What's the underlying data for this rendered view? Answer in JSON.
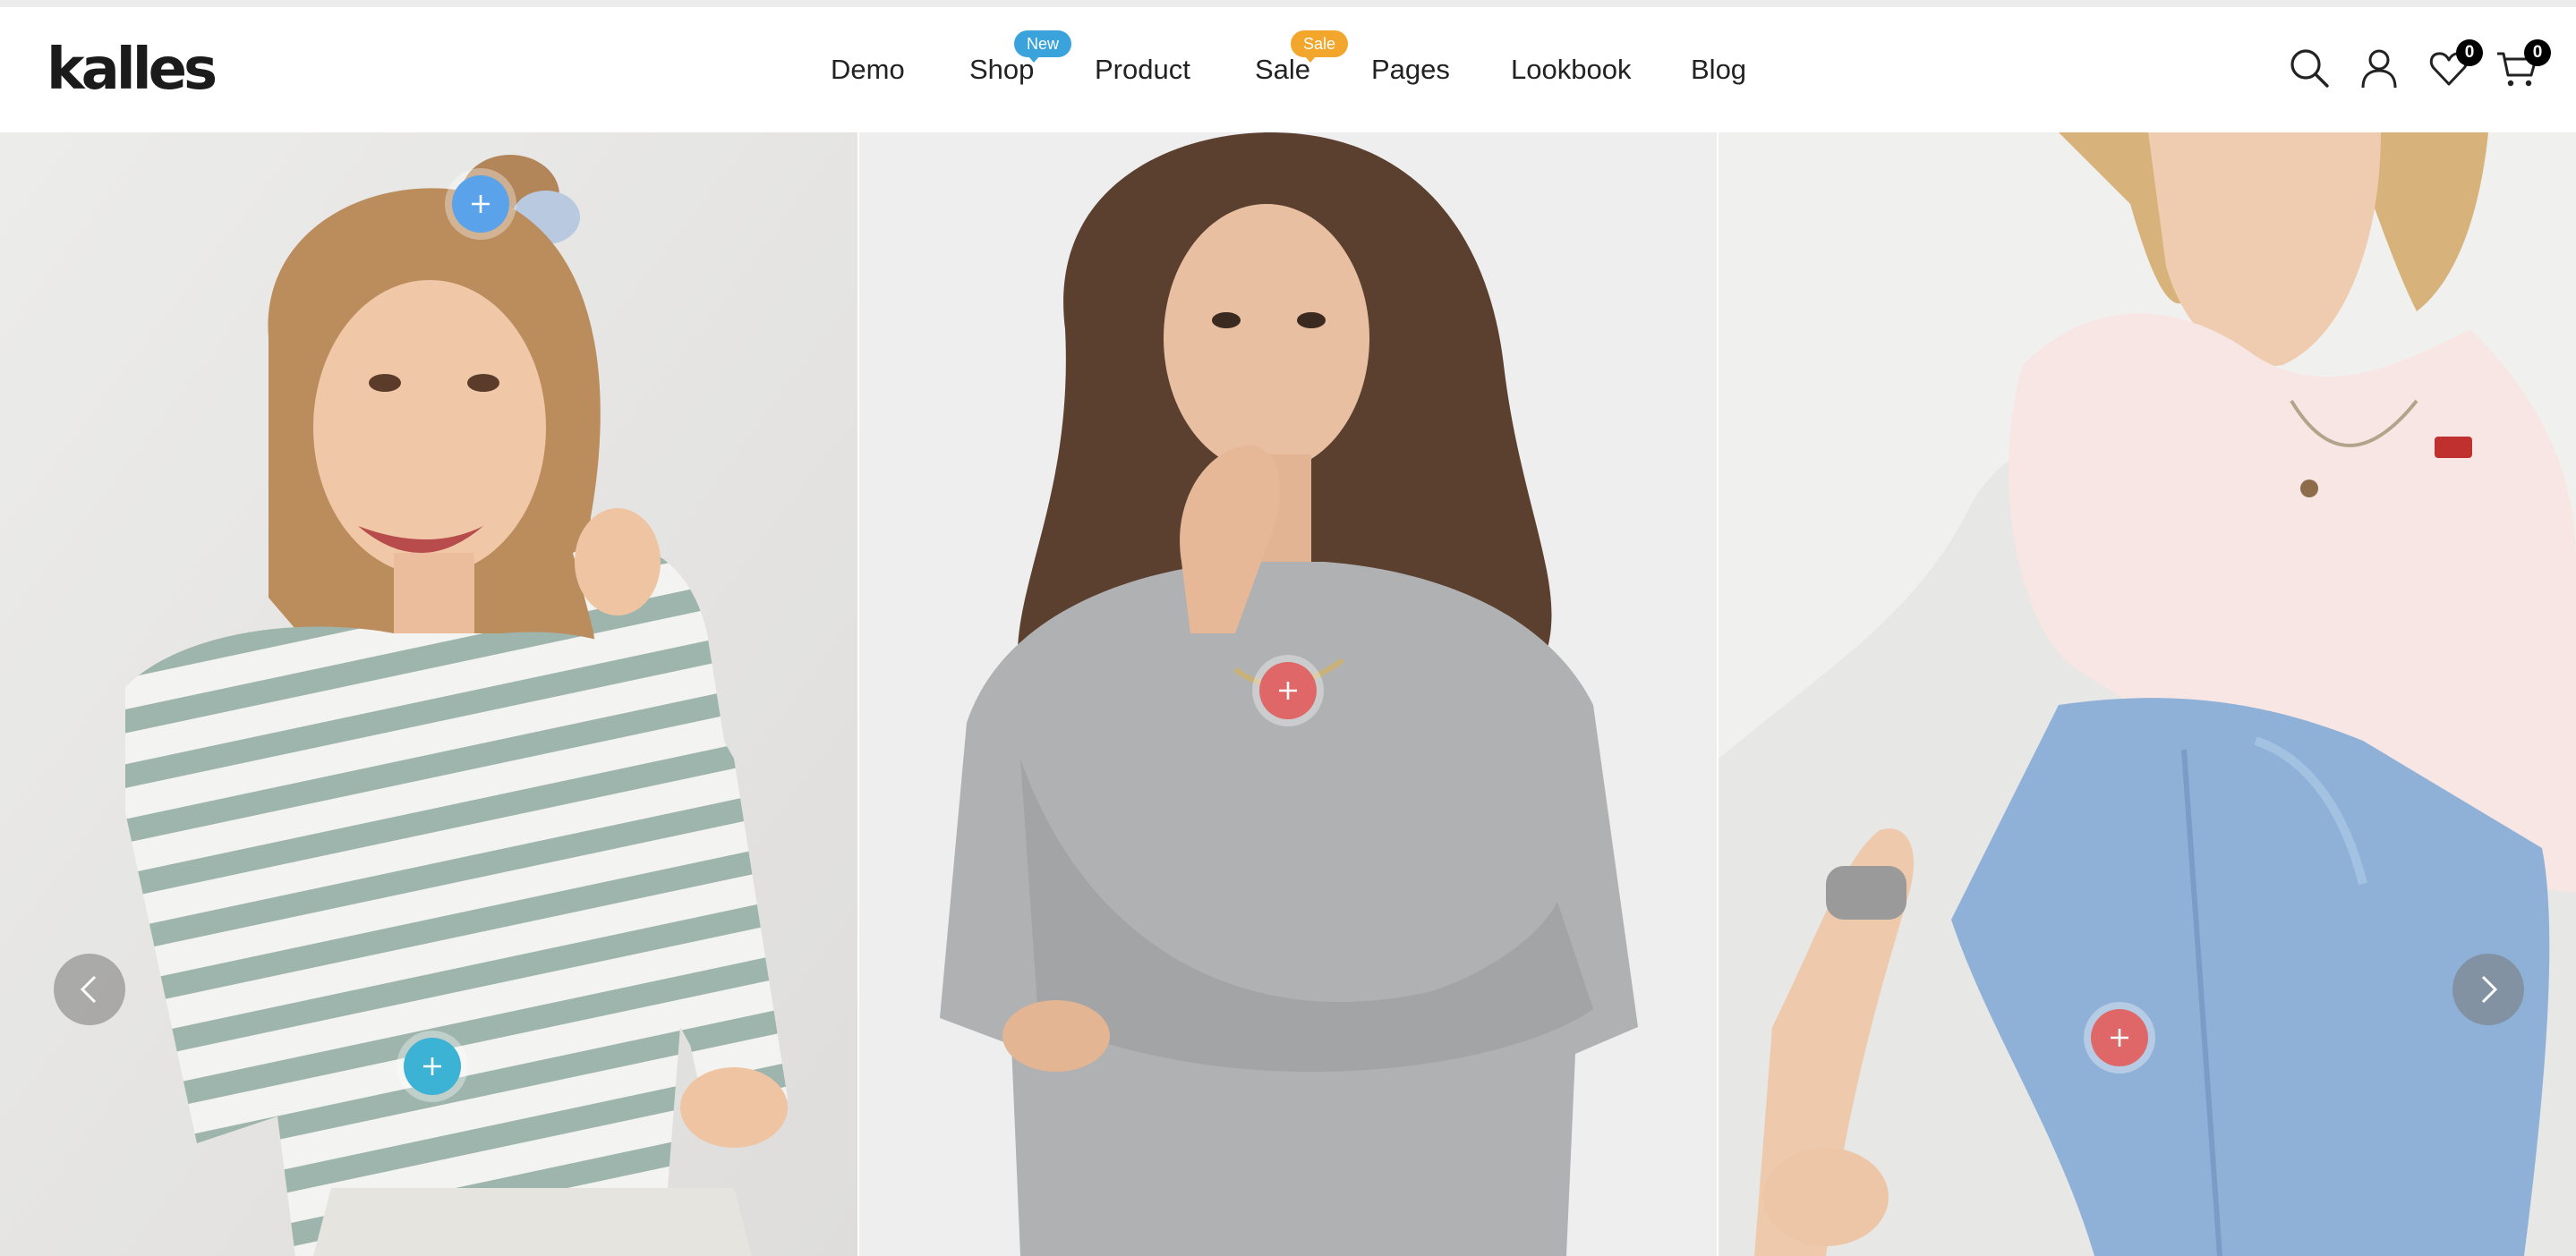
{
  "brand": {
    "logo_text": "kalles"
  },
  "nav": {
    "items": [
      {
        "label": "Demo"
      },
      {
        "label": "Shop",
        "badge": "New",
        "badge_color": "#3aa3dc"
      },
      {
        "label": "Product"
      },
      {
        "label": "Sale",
        "badge": "Sale",
        "badge_color": "#f2a72c"
      },
      {
        "label": "Pages"
      },
      {
        "label": "Lookbook"
      },
      {
        "label": "Blog"
      }
    ]
  },
  "header_icons": {
    "search": "search-icon",
    "account": "user-icon",
    "wishlist": {
      "icon": "heart-icon",
      "count": "0"
    },
    "cart": {
      "icon": "cart-icon",
      "count": "0"
    }
  },
  "hero": {
    "slides": [
      {
        "name": "model-striped-sweater",
        "hotspots": [
          {
            "color": "#5aa2ea"
          },
          {
            "color": "#3cb2d4"
          }
        ]
      },
      {
        "name": "model-grey-sweatshirt",
        "hotspots": [
          {
            "color": "#e06767"
          }
        ]
      },
      {
        "name": "model-tee-and-jeans",
        "hotspots": [
          {
            "color": "#e06767"
          }
        ]
      }
    ],
    "controls": {
      "prev_icon": "chevron-left-icon",
      "next_icon": "chevron-right-icon"
    }
  }
}
